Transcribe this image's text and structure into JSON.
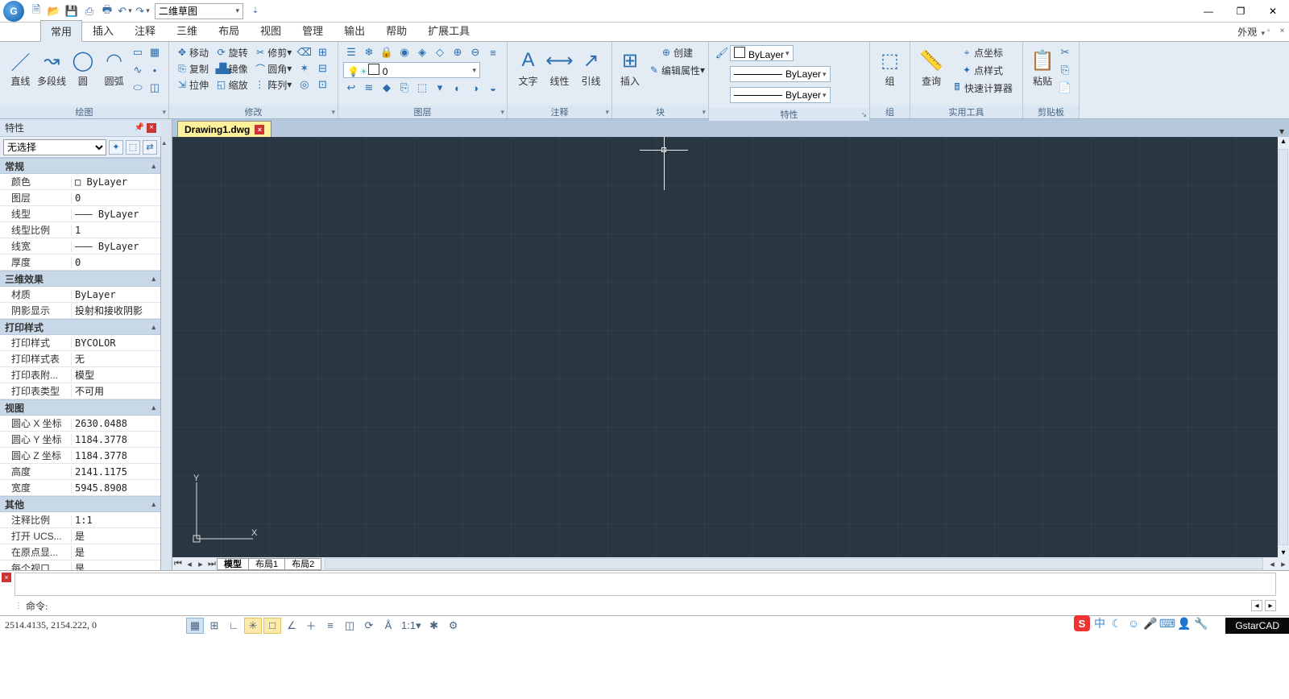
{
  "qat": {
    "workspace": "二维草图"
  },
  "window_controls": {
    "min": "—",
    "max": "❐",
    "close": "✕"
  },
  "ribbon_tabs": [
    "常用",
    "插入",
    "注释",
    "三维",
    "布局",
    "视图",
    "管理",
    "输出",
    "帮助",
    "扩展工具"
  ],
  "ribbon_active": 0,
  "ribbon_right": "外观",
  "groups": {
    "draw": {
      "label": "绘图",
      "line": "直线",
      "pline": "多段线",
      "circle": "圆",
      "arc": "圆弧"
    },
    "modify": {
      "label": "修改",
      "move": "移动",
      "rotate": "旋转",
      "trim": "修剪",
      "copy": "复制",
      "mirror": "镜像",
      "fillet": "圆角",
      "stretch": "拉伸",
      "scale": "缩放",
      "array": "阵列"
    },
    "layer": {
      "label": "图层",
      "current": "0"
    },
    "annot": {
      "label": "注释",
      "text": "文字",
      "dim": "线性",
      "leader": "引线"
    },
    "block": {
      "label": "块",
      "insert": "插入",
      "create": "创建",
      "edit": "编辑属性"
    },
    "props": {
      "label": "特性",
      "color": "ByLayer",
      "ltype": "ByLayer",
      "lweight": "ByLayer"
    },
    "grp": {
      "label": "组",
      "group": "组"
    },
    "util": {
      "label": "实用工具",
      "measure": "查询",
      "pointcoord": "点坐标",
      "pointstyle": "点样式",
      "calc": "快速计算器"
    },
    "clip": {
      "label": "剪贴板",
      "paste": "粘贴"
    }
  },
  "doc_tab": "Drawing1.dwg",
  "props_panel": {
    "title": "特性",
    "selection": "无选择",
    "cats": [
      {
        "name": "常规",
        "rows": [
          {
            "k": "颜色",
            "v": "□ ByLayer"
          },
          {
            "k": "图层",
            "v": "0"
          },
          {
            "k": "线型",
            "v": "——— ByLayer"
          },
          {
            "k": "线型比例",
            "v": "1"
          },
          {
            "k": "线宽",
            "v": "——— ByLayer"
          },
          {
            "k": "厚度",
            "v": "0"
          }
        ]
      },
      {
        "name": "三维效果",
        "rows": [
          {
            "k": "材质",
            "v": "ByLayer"
          },
          {
            "k": "阴影显示",
            "v": "投射和接收阴影"
          }
        ]
      },
      {
        "name": "打印样式",
        "rows": [
          {
            "k": "打印样式",
            "v": "BYCOLOR"
          },
          {
            "k": "打印样式表",
            "v": "无"
          },
          {
            "k": "打印表附...",
            "v": "模型"
          },
          {
            "k": "打印表类型",
            "v": "不可用"
          }
        ]
      },
      {
        "name": "视图",
        "rows": [
          {
            "k": "圆心 X 坐标",
            "v": "2630.0488"
          },
          {
            "k": "圆心 Y 坐标",
            "v": "1184.3778"
          },
          {
            "k": "圆心 Z 坐标",
            "v": "1184.3778"
          },
          {
            "k": "高度",
            "v": "2141.1175"
          },
          {
            "k": "宽度",
            "v": "5945.8908"
          }
        ]
      },
      {
        "name": "其他",
        "rows": [
          {
            "k": "注释比例",
            "v": "1:1"
          },
          {
            "k": "打开 UCS...",
            "v": "是"
          },
          {
            "k": "在原点显...",
            "v": "是"
          },
          {
            "k": "每个视口...",
            "v": "是"
          }
        ]
      }
    ]
  },
  "layout_tabs": [
    "模型",
    "布局1",
    "布局2"
  ],
  "layout_active": 0,
  "command": {
    "prompt": "命令:"
  },
  "status": {
    "coords": "2514.4135, 2154.222, 0",
    "scale": "1:1",
    "brand": "GstarCAD"
  },
  "ime": {
    "logo": "S",
    "lang": "中"
  }
}
